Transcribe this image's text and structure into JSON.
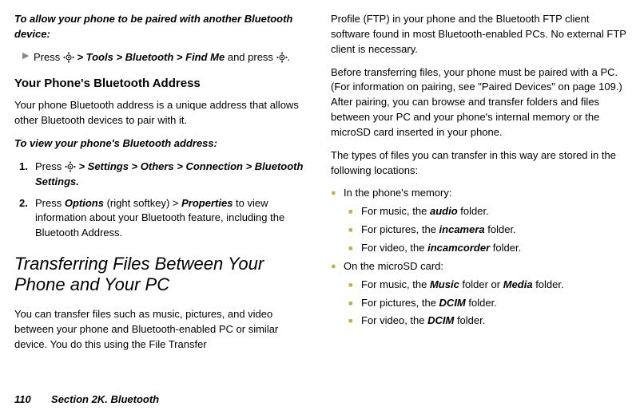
{
  "left": {
    "intro1": "To allow your phone to be paired with another Bluetooth device:",
    "instr1_a": "Press ",
    "instr1_b": " > Tools > Bluetooth  > Find Me ",
    "instr1_c": "and press ",
    "instr1_d": ".",
    "h3_1": "Your Phone's Bluetooth Address",
    "p1": "Your phone Bluetooth address is a unique address that allows other Bluetooth devices to pair with it.",
    "intro2": "To view your phone's Bluetooth address:",
    "step1_a": "Press ",
    "step1_b": " > Settings > Others > Connection > Bluetooth Settings.",
    "step2_a": "Press ",
    "step2_b": "Options",
    "step2_c": " (right softkey) > ",
    "step2_d": "Properties",
    "step2_e": " to view information about your Bluetooth feature, including the Bluetooth Address.",
    "h2": "Transferring Files Between Your Phone and Your PC",
    "p2": "You can transfer files such as music, pictures, and video between your phone and Bluetooth-enabled PC or similar device. You do this using the File Transfer"
  },
  "right": {
    "p1": "Profile (FTP) in your phone and the Bluetooth FTP client software found in most Bluetooth-enabled PCs. No external FTP client is necessary.",
    "p2": "Before transferring files, your phone must be paired with a PC. (For information on pairing, see \"Paired Devices\" on page 109.) After pairing, you can browse and transfer folders and files between your PC and your phone's internal memory or the microSD card inserted in your phone.",
    "p3": "The types of files you can transfer in this way are stored in the following locations:",
    "b1": "In the phone's memory:",
    "b1_1a": "For music, the ",
    "b1_1b": "audio",
    "b1_1c": " folder.",
    "b1_2a": "For pictures, the ",
    "b1_2b": "incamera",
    "b1_2c": " folder.",
    "b1_3a": "For video, the ",
    "b1_3b": "incamcorder",
    "b1_3c": " folder.",
    "b2": "On the microSD card:",
    "b2_1a": "For music, the ",
    "b2_1b": "Music",
    "b2_1c": " folder or ",
    "b2_1d": "Media",
    "b2_1e": " folder.",
    "b2_2a": "For pictures, the ",
    "b2_2b": "DCIM",
    "b2_2c": " folder.",
    "b2_3a": "For video, the ",
    "b2_3b": "DCIM",
    "b2_3c": " folder."
  },
  "footer": {
    "page": "110",
    "section": "Section 2K. Bluetooth"
  }
}
